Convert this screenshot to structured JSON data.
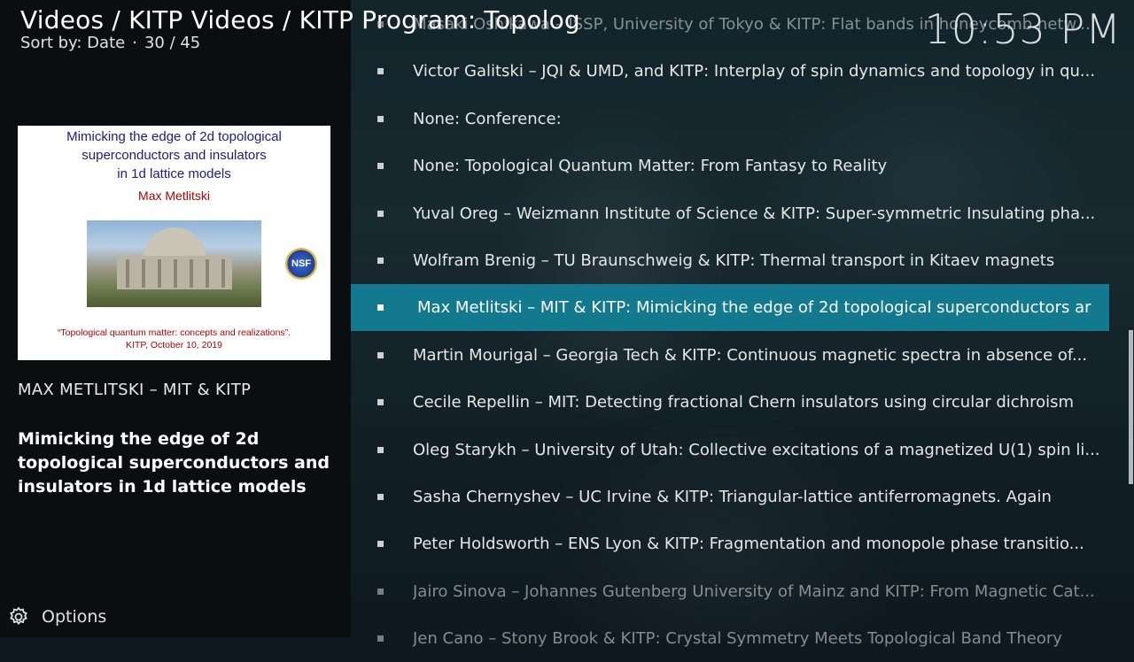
{
  "header": {
    "breadcrumb": "Videos / KITP Videos / KITP Program: Topolog",
    "sort_label": "Sort by: Date",
    "separator": "·",
    "position": "30 / 45",
    "clock": "10:53 PM"
  },
  "selected_item": {
    "thumbnail": {
      "title_line1": "Mimicking the edge of 2d topological",
      "title_line2": "superconductors and insulators",
      "title_line3": "in 1d lattice models",
      "author": "Max Metlitski",
      "logo_text": "NSF",
      "event_line1": "“Topological quantum matter: concepts and realizations”.",
      "event_line2": "KITP, October 10, 2019"
    },
    "title": "MAX METLITSKI – MIT & KITP",
    "plot": "Mimicking the edge of 2d topological superconductors and insulators in 1d lattice models"
  },
  "footer": {
    "options_label": "Options",
    "options_icon": "options-gear-icon"
  },
  "list": {
    "items": [
      {
        "label": "Masaki Oshikawa – ISSP, University of Tokyo & KITP: Flat bands in honeycomb netw...",
        "state": "faded"
      },
      {
        "label": "Victor Galitski – JQI & UMD, and KITP: Interplay of spin dynamics and topology in qu...",
        "state": "normal"
      },
      {
        "label": "None: Conference:",
        "state": "normal"
      },
      {
        "label": "None: Topological Quantum Matter: From Fantasy to Reality",
        "state": "normal"
      },
      {
        "label": "Yuval Oreg – Weizmann Institute of Science & KITP: Super-symmetric Insulating pha...",
        "state": "normal"
      },
      {
        "label": "Wolfram Brenig – TU Braunschweig & KITP: Thermal transport in Kitaev magnets",
        "state": "normal"
      },
      {
        "label": "Max Metlitski – MIT & KITP: Mimicking the edge of 2d topological superconductors ar",
        "state": "selected"
      },
      {
        "label": "Martin Mourigal – Georgia Tech & KITP: Continuous magnetic spectra in absence of...",
        "state": "normal"
      },
      {
        "label": "Cecile Repellin – MIT: Detecting fractional Chern insulators using circular dichroism",
        "state": "normal"
      },
      {
        "label": "Oleg Starykh – University of Utah: Collective excitations of a magnetized U(1) spin li...",
        "state": "normal"
      },
      {
        "label": "Sasha Chernyshev – UC Irvine & KITP: Triangular-lattice antiferromagnets. Again",
        "state": "normal"
      },
      {
        "label": "Peter Holdsworth – ENS Lyon & KITP: Fragmentation and monopole phase transitio...",
        "state": "normal"
      },
      {
        "label": "Jairo Sinova – Johannes Gutenberg University of Mainz and KITP: From Magnetic Cat...",
        "state": "faded"
      },
      {
        "label": "Jen Cano – Stony Brook & KITP: Crystal Symmetry Meets Topological Band Theory",
        "state": "faded"
      }
    ]
  },
  "colors": {
    "selected_row": "#12798f",
    "thumb_title": "#1b1b8a",
    "thumb_author": "#b00000"
  }
}
